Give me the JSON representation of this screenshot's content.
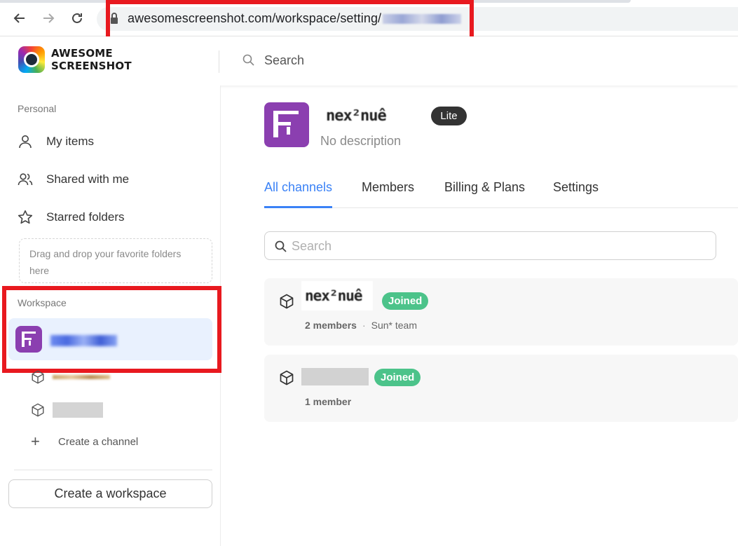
{
  "browser": {
    "url_visible": "awesomescreenshot.com/workspace/setting/"
  },
  "header": {
    "logo_text_line1": "AWESOME",
    "logo_text_line2": "SCREENSHOT",
    "search_label": "Search"
  },
  "sidebar": {
    "personal_label": "Personal",
    "items": [
      {
        "label": "My items",
        "icon": "user-icon"
      },
      {
        "label": "Shared with me",
        "icon": "users-icon"
      },
      {
        "label": "Starred folders",
        "icon": "star-icon"
      }
    ],
    "dropzone_text": "Drag and drop your favorite folders here",
    "workspace_label": "Workspace",
    "create_channel_label": "Create a channel",
    "create_workspace_label": "Create a workspace"
  },
  "main": {
    "workspace_title": "nex²nuê",
    "description": "No description",
    "plan_badge": "Lite",
    "tabs": [
      {
        "label": "All channels",
        "active": true
      },
      {
        "label": "Members",
        "active": false
      },
      {
        "label": "Billing & Plans",
        "active": false
      },
      {
        "label": "Settings",
        "active": false
      }
    ],
    "search_placeholder": "Search",
    "channels": [
      {
        "name": "nex²nuê",
        "status": "Joined",
        "members": "2 members",
        "team": "Sun* team"
      },
      {
        "name": "",
        "status": "Joined",
        "members": "1 member",
        "team": ""
      }
    ]
  },
  "colors": {
    "accent": "#3b82f6",
    "joined": "#4cc38a",
    "avatar": "#8b3fb0",
    "highlight": "#e8191f"
  }
}
